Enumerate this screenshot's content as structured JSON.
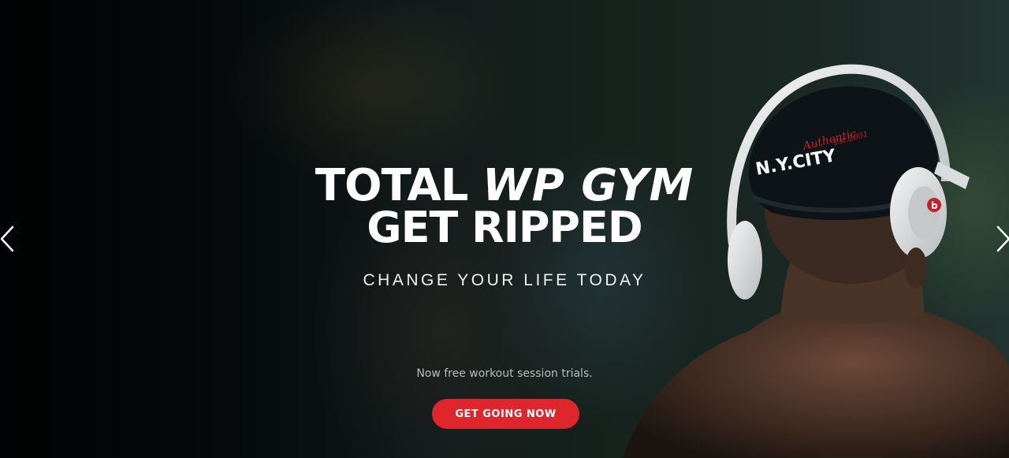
{
  "hero": {
    "title_line1_part1": "TOTAL",
    "title_line1_part2": "WP GYM",
    "title_line2": "GET RIPPED",
    "subheading": "CHANGE YOUR LIFE TODAY",
    "tagline": "Now free workout session trials.",
    "cta_label": "GET GOING NOW"
  },
  "slider": {
    "prev_icon": "chevron-left-icon",
    "next_icon": "chevron-right-icon"
  },
  "image": {
    "cap_text": "N.Y.CITY",
    "cap_script": "Authentic",
    "cap_year": "Est.2001",
    "headphone_logo": "b"
  },
  "colors": {
    "accent": "#e0262d",
    "text": "#ffffff",
    "tagline": "#b9bcbc"
  }
}
